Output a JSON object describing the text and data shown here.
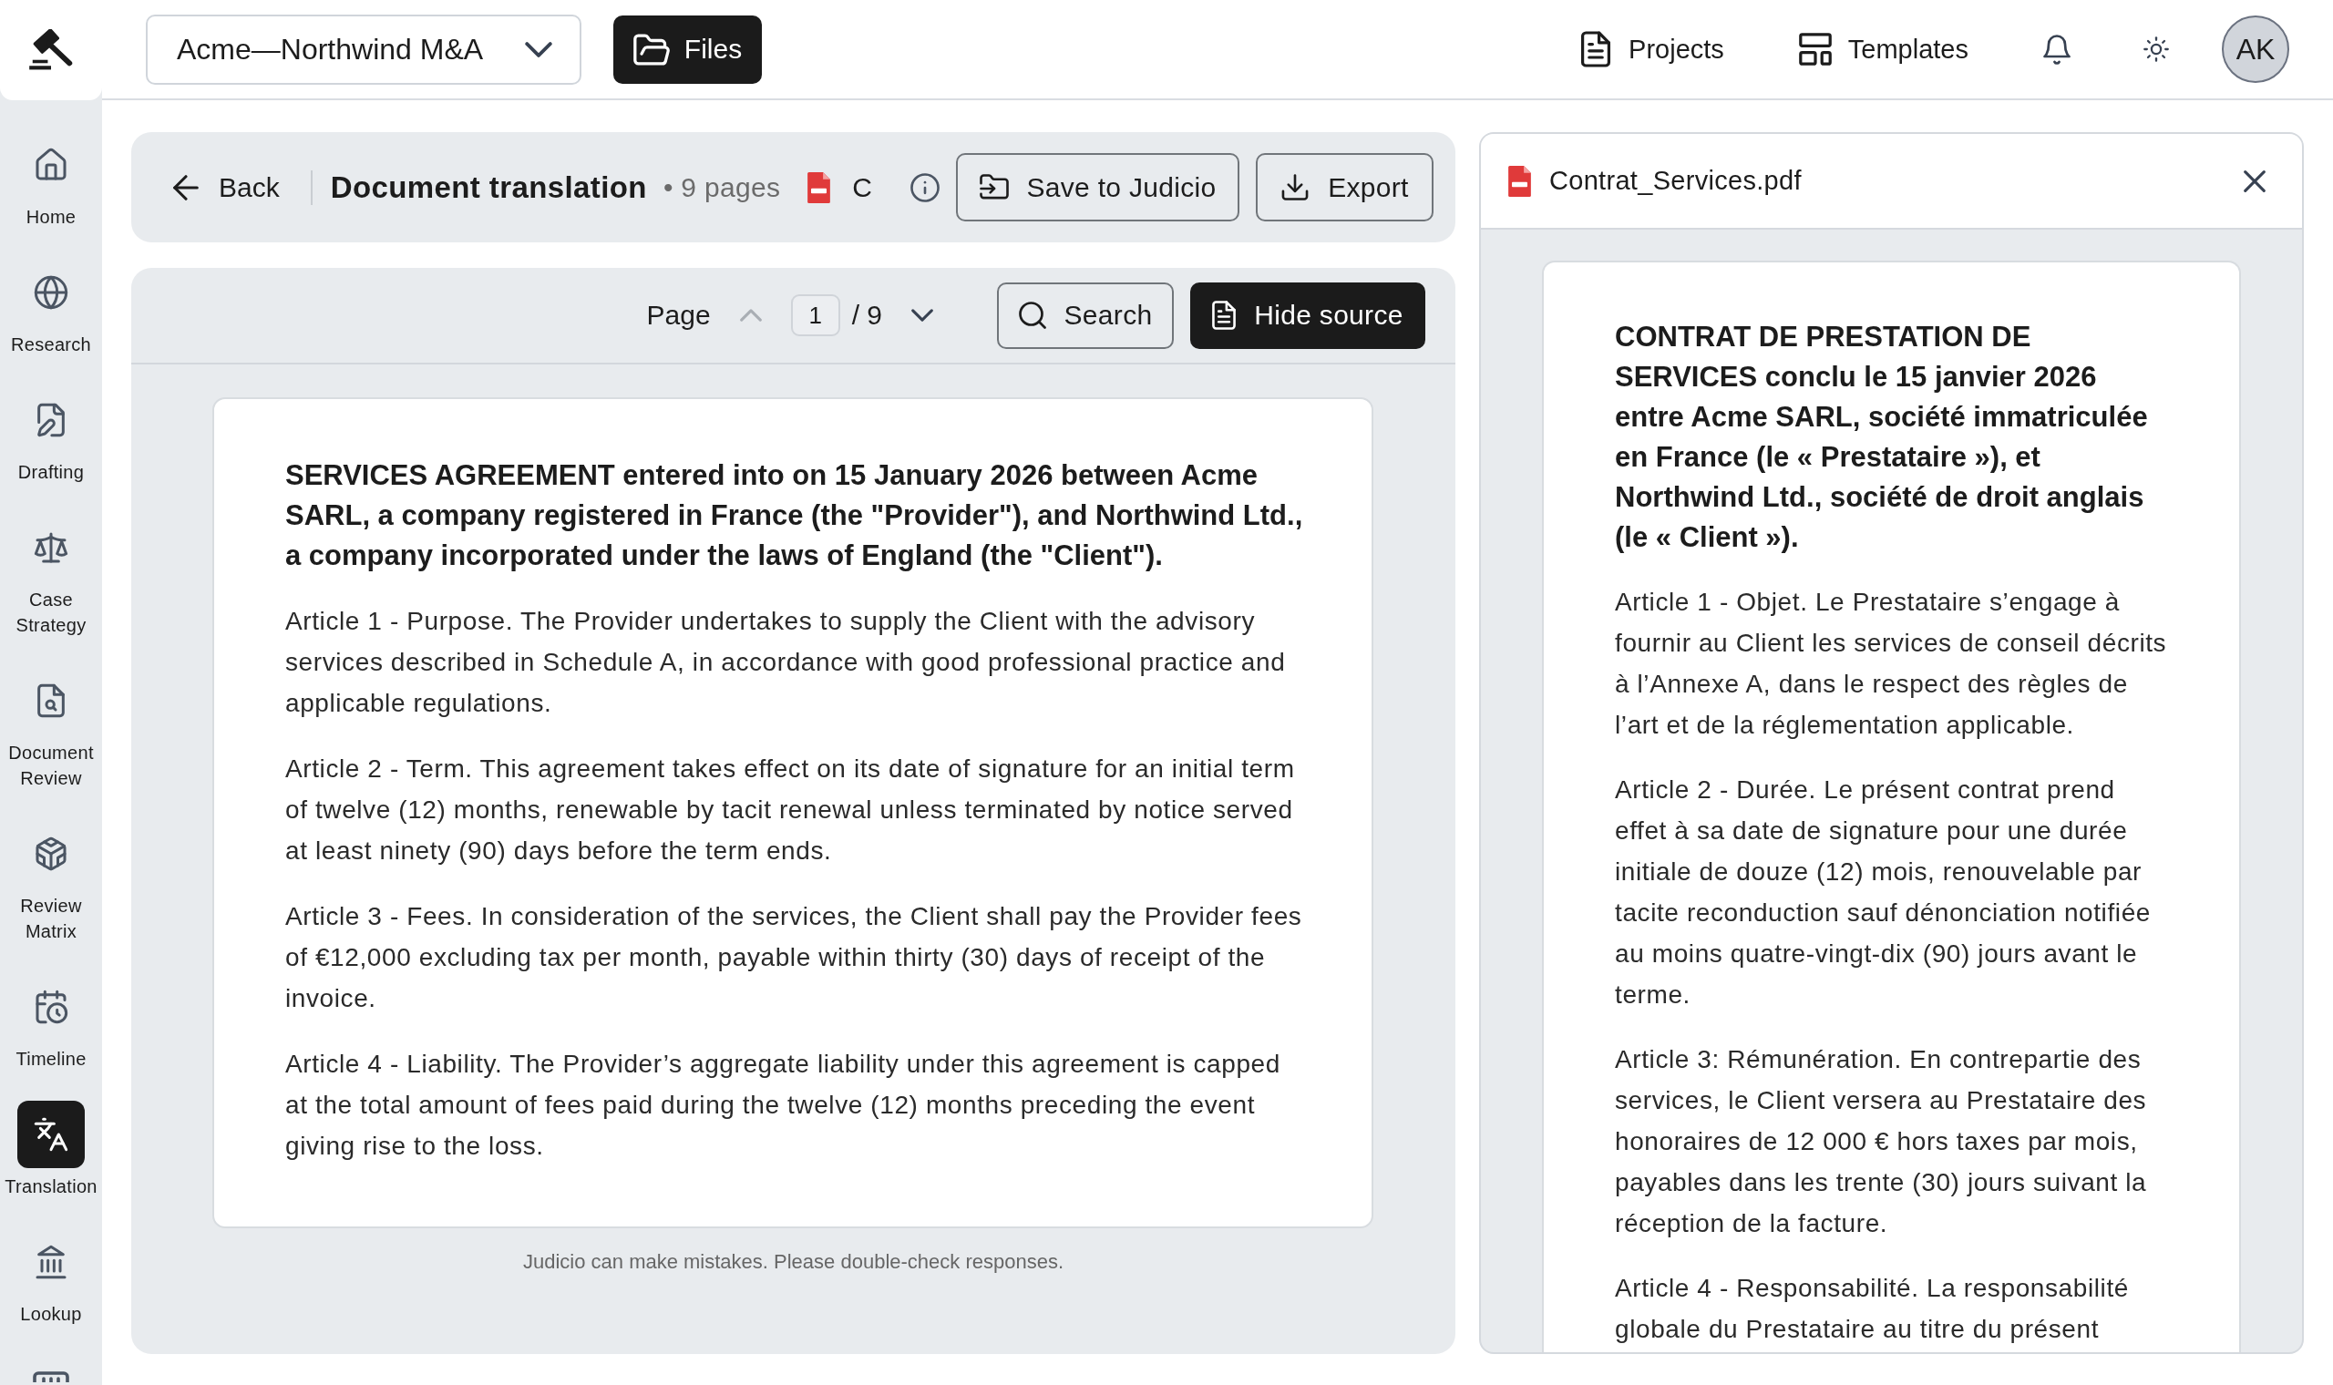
{
  "top_bar": {
    "project_selector": {
      "value": "Acme—Northwind M&A"
    },
    "files_button": {
      "label": "Files"
    },
    "nav": [
      {
        "label": "Projects"
      },
      {
        "label": "Templates"
      }
    ],
    "avatar": {
      "initials": "AK"
    }
  },
  "sidebar": {
    "items": [
      {
        "label": "Home",
        "selected": false
      },
      {
        "label": "Research",
        "selected": false
      },
      {
        "label": "Drafting",
        "selected": false
      },
      {
        "label": "Case Strategy",
        "selected": false
      },
      {
        "label": "Document Review",
        "selected": false
      },
      {
        "label": "Review Matrix",
        "selected": false
      },
      {
        "label": "Timeline",
        "selected": false
      },
      {
        "label": "Translation",
        "selected": true
      },
      {
        "label": "Lookup",
        "selected": false
      },
      {
        "selected": false
      }
    ]
  },
  "header": {
    "back": {
      "label": "Back"
    },
    "title": "Document translation",
    "meta": "• 9 pages",
    "file_name": "C",
    "buttons": [
      {
        "label": "Save to Judicio"
      },
      {
        "label": "Export"
      }
    ]
  },
  "viewer": {
    "pager": {
      "label": "Page",
      "current": "1",
      "total": "/ 9",
      "prev_disabled": true,
      "next_disabled": false
    },
    "search_button": {
      "label": "Search"
    },
    "source_button": {
      "label": "Hide source"
    },
    "document": {
      "heading": "SERVICES AGREEMENT entered into on 15 January 2026 between Acme SARL, a company registered in France (the \"Provider\"), and Northwind Ltd., a company incorporated under the laws of England (the \"Client\").",
      "paragraphs": [
        "Article 1 - Purpose. The Provider undertakes to supply the Client with the advisory services described in Schedule A, in accordance with good professional practice and applicable regulations.",
        "Article 2 - Term. This agreement takes effect on its date of signature for an initial term of twelve (12) months, renewable by tacit renewal unless terminated by notice served at least ninety (90) days before the term ends.",
        "Article 3 - Fees. In consideration of the services, the Client shall pay the Provider fees of €12,000 excluding tax per month, payable within thirty (30) days of receipt of the invoice.",
        "Article 4 - Liability. The Provider’s aggregate liability under this agreement is capped at the total amount of fees paid during the twelve (12) months preceding the event giving rise to the loss."
      ]
    },
    "disclaimer": "Judicio can make mistakes. Please double-check responses."
  },
  "source_panel": {
    "file_name": "Contrat_Services.pdf",
    "document": {
      "heading": "CONTRAT DE PRESTATION DE SERVICES conclu le 15 janvier 2026 entre Acme SARL, société immatriculée en France (le « Prestataire »), et Northwind Ltd., société de droit anglais (le « Client »).",
      "paragraphs": [
        "Article 1 - Objet. Le Prestataire s’engage à fournir au Client les services de conseil décrits à l’Annexe A, dans le respect des règles de l’art et de la réglementation applicable.",
        "Article 2 - Durée. Le présent contrat prend effet à sa date de signature pour une durée initiale de douze (12) mois, renouvelable par tacite reconduction sauf dénonciation notifiée au moins quatre-vingt-dix (90) jours avant le terme.",
        "Article 3: Rémunération. En contrepartie des services, le Client versera au Prestataire des honoraires de 12 000 € hors taxes par mois, payables dans les trente (30) jours suivant la réception de la facture.",
        "Article 4 - Responsabilité. La responsabilité globale du Prestataire au titre du présent"
      ]
    }
  }
}
